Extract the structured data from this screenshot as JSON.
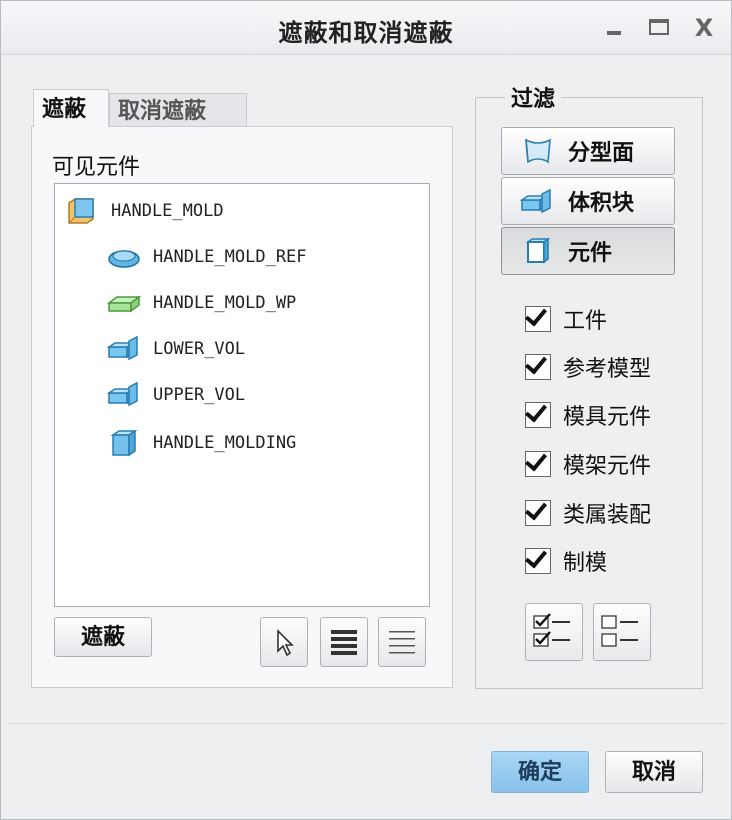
{
  "window": {
    "title": "遮蔽和取消遮蔽",
    "controls": {
      "minimize": "–",
      "maximize": "□",
      "close": "X"
    }
  },
  "tabs": [
    {
      "label": "遮蔽",
      "active": true
    },
    {
      "label": "取消遮蔽",
      "active": false
    }
  ],
  "left": {
    "list_label": "可见元件",
    "items": [
      {
        "name": "HANDLE_MOLD",
        "icon": "assembly-icon",
        "indent": 0
      },
      {
        "name": "HANDLE_MOLD_REF",
        "icon": "reference-model-icon",
        "indent": 1
      },
      {
        "name": "HANDLE_MOLD_WP",
        "icon": "workpiece-icon",
        "indent": 1
      },
      {
        "name": "LOWER_VOL",
        "icon": "volume-icon",
        "indent": 1
      },
      {
        "name": "UPPER_VOL",
        "icon": "volume-icon",
        "indent": 1
      },
      {
        "name": "HANDLE_MOLDING",
        "icon": "molding-part-icon",
        "indent": 1
      }
    ],
    "hide_button": "遮蔽"
  },
  "filter": {
    "title": "过滤",
    "buttons": [
      {
        "label": "分型面",
        "icon": "parting-surface-icon",
        "pressed": false
      },
      {
        "label": "体积块",
        "icon": "volume-block-icon",
        "pressed": false
      },
      {
        "label": "元件",
        "icon": "component-icon",
        "pressed": true
      }
    ],
    "checkboxes": [
      {
        "label": "工件",
        "checked": true
      },
      {
        "label": "参考模型",
        "checked": true
      },
      {
        "label": "模具元件",
        "checked": true
      },
      {
        "label": "模架元件",
        "checked": true
      },
      {
        "label": "类属装配",
        "checked": true
      },
      {
        "label": "制模",
        "checked": true
      }
    ]
  },
  "footer": {
    "ok": "确定",
    "cancel": "取消"
  },
  "colors": {
    "accent_ok": "#88c1ea",
    "icon_blue": "#5fb4e6",
    "icon_green": "#a8e39a",
    "icon_orange": "#e9a54a"
  }
}
